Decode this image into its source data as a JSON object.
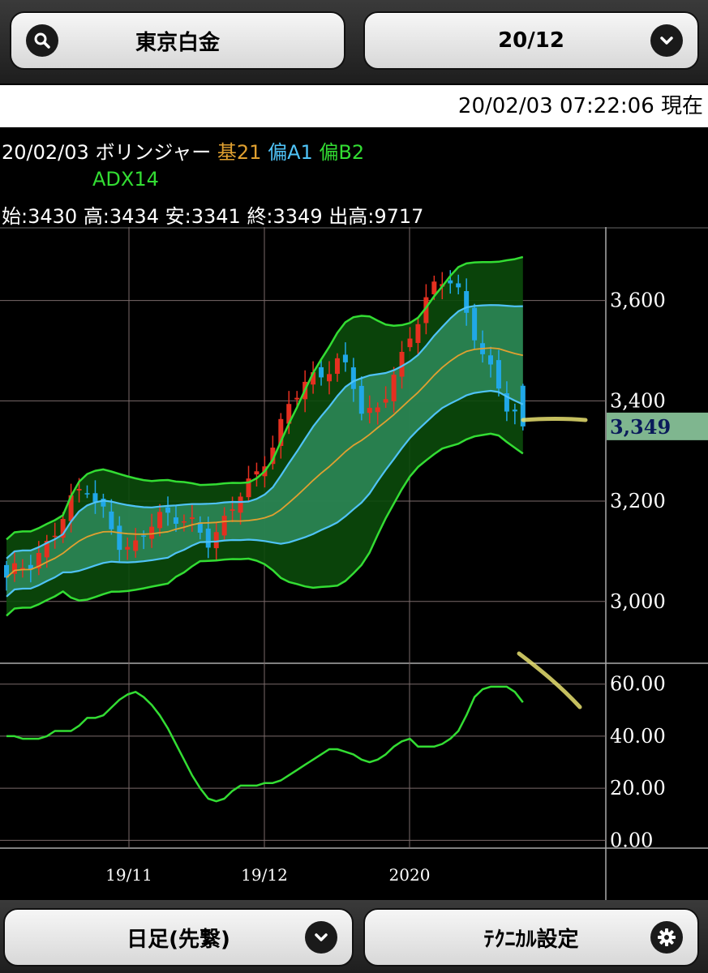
{
  "header": {
    "left_label": "東京白金",
    "right_label": "20/12"
  },
  "timestamp": "20/02/03 07:22:06 現在",
  "indicator_line": {
    "date": "20/02/03",
    "name": "ボリンジャー",
    "base": "基21",
    "dev_a": "偏A1",
    "dev_b": "偏B2",
    "sub": "ADX14"
  },
  "ohlc": {
    "open": "始:3430",
    "high": "高:3434",
    "low": "安:3341",
    "close": "終:3349",
    "volume": "出高:9717"
  },
  "colors": {
    "base": "#e0a030",
    "dev_a": "#4fc3f7",
    "dev_b": "#33dd33",
    "up": "#e53020",
    "down": "#20a8e8",
    "price_tag": "#7fb68f"
  },
  "chart_data": [
    {
      "type": "candlestick",
      "title": "",
      "yticks": [
        "3,600",
        "3,400",
        "3,200",
        "3,000"
      ],
      "ylim": [
        2880,
        3740
      ],
      "xtick_labels": [
        "19/11",
        "19/12",
        "2020"
      ],
      "last_price": "3,349",
      "series": [
        {
          "name": "基21"
        },
        {
          "name": "偏A1"
        },
        {
          "name": "偏B2"
        }
      ]
    },
    {
      "type": "line",
      "title": "",
      "yticks": [
        "60.00",
        "40.00",
        "20.00",
        "0.00"
      ],
      "ylim": [
        -3,
        68
      ],
      "series": [
        {
          "name": "ADX14",
          "values": [
            40,
            40,
            39,
            39,
            39,
            40,
            42,
            42,
            42,
            44,
            47,
            47,
            48,
            51,
            54,
            56,
            57,
            55,
            52,
            48,
            43,
            37,
            31,
            25,
            20,
            16,
            15,
            16,
            19,
            21,
            21,
            21,
            22,
            22,
            23,
            25,
            27,
            29,
            31,
            33,
            35,
            35,
            34,
            33,
            31,
            30,
            31,
            33,
            36,
            38,
            39,
            36,
            36,
            36,
            37,
            39,
            42,
            48,
            55,
            58,
            59,
            59,
            59,
            57,
            53
          ]
        }
      ]
    }
  ],
  "footer": {
    "left_label": "日足(先繋)",
    "right_label": "ﾃｸﾆｶﾙ設定"
  }
}
